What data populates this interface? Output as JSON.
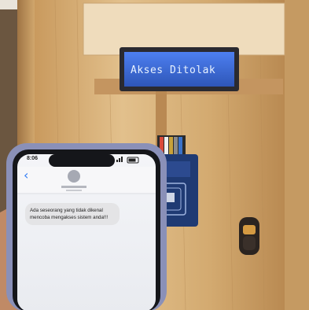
{
  "lcd": {
    "message": "Akses Ditolak"
  },
  "phone": {
    "status_time": "8:06",
    "back_glyph": "‹",
    "sms_text_line1": "Ada seseorang yang tidak dikenal",
    "sms_text_line2": "mencoba mengakses sistem anda!!!"
  },
  "colors": {
    "wall": "#f2f0ea",
    "wood": "#d9b47f",
    "lcd_backlight": "#3f6fd8",
    "rfid_board": "#1f3a73",
    "phone_frame": "#8a90b8",
    "bubble": "#e4e4e6"
  },
  "icons": [
    "back-chevron-icon",
    "contact-avatar-icon",
    "status-signal-icon",
    "battery-icon"
  ]
}
